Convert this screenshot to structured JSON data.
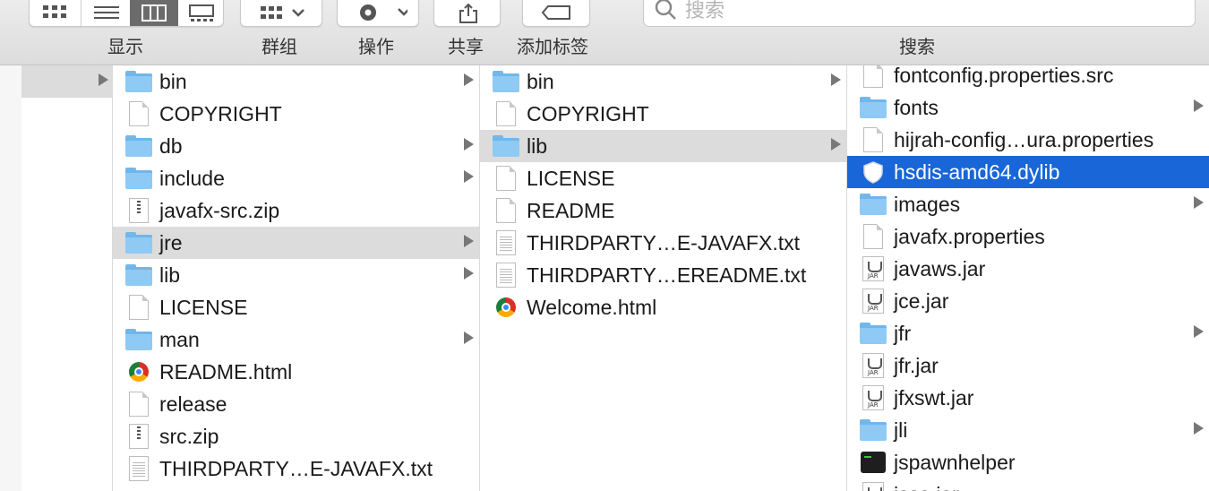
{
  "toolbar": {
    "view_label": "显示",
    "group_label": "群组",
    "action_label": "操作",
    "share_label": "共享",
    "tag_label": "添加标签",
    "search_label": "搜索",
    "search_placeholder": "搜索"
  },
  "columns": {
    "col2": [
      {
        "name": "bin",
        "icon": "folder-icon",
        "arrow": true
      },
      {
        "name": "COPYRIGHT",
        "icon": "document-icon"
      },
      {
        "name": "db",
        "icon": "folder-icon",
        "arrow": true
      },
      {
        "name": "include",
        "icon": "folder-icon",
        "arrow": true
      },
      {
        "name": "javafx-src.zip",
        "icon": "zip-icon"
      },
      {
        "name": "jre",
        "icon": "folder-icon",
        "arrow": true,
        "state": "highlighted"
      },
      {
        "name": "lib",
        "icon": "folder-icon",
        "arrow": true
      },
      {
        "name": "LICENSE",
        "icon": "document-icon"
      },
      {
        "name": "man",
        "icon": "folder-icon",
        "arrow": true
      },
      {
        "name": "README.html",
        "icon": "chrome-icon"
      },
      {
        "name": "release",
        "icon": "document-icon"
      },
      {
        "name": "src.zip",
        "icon": "zip-icon"
      },
      {
        "name": "THIRDPARTY…E-JAVAFX.txt",
        "icon": "text-document-icon"
      }
    ],
    "col3": [
      {
        "name": "bin",
        "icon": "folder-icon",
        "arrow": true
      },
      {
        "name": "COPYRIGHT",
        "icon": "document-icon"
      },
      {
        "name": "lib",
        "icon": "folder-icon",
        "arrow": true,
        "state": "highlighted"
      },
      {
        "name": "LICENSE",
        "icon": "document-icon"
      },
      {
        "name": "README",
        "icon": "document-icon"
      },
      {
        "name": "THIRDPARTY…E-JAVAFX.txt",
        "icon": "text-document-icon"
      },
      {
        "name": "THIRDPARTY…EREADME.txt",
        "icon": "text-document-icon"
      },
      {
        "name": "Welcome.html",
        "icon": "chrome-icon"
      }
    ],
    "col4": [
      {
        "name": "fontconfig.properties.src",
        "icon": "document-icon"
      },
      {
        "name": "fonts",
        "icon": "folder-icon",
        "arrow": true
      },
      {
        "name": "hijrah-config…ura.properties",
        "icon": "document-icon"
      },
      {
        "name": "hsdis-amd64.dylib",
        "icon": "shield-icon",
        "state": "selected"
      },
      {
        "name": "images",
        "icon": "folder-icon",
        "arrow": true
      },
      {
        "name": "javafx.properties",
        "icon": "document-icon"
      },
      {
        "name": "javaws.jar",
        "icon": "jar-icon"
      },
      {
        "name": "jce.jar",
        "icon": "jar-icon"
      },
      {
        "name": "jfr",
        "icon": "folder-icon",
        "arrow": true
      },
      {
        "name": "jfr.jar",
        "icon": "jar-icon"
      },
      {
        "name": "jfxswt.jar",
        "icon": "jar-icon"
      },
      {
        "name": "jli",
        "icon": "folder-icon",
        "arrow": true
      },
      {
        "name": "jspawnhelper",
        "icon": "executable-icon"
      },
      {
        "name": "jsse.jar",
        "icon": "jar-icon"
      }
    ]
  },
  "jar_badge": "JAR",
  "colors": {
    "selection": "#1866d8",
    "highlight": "#dcdcdc",
    "folder": "#8fcaf4"
  }
}
